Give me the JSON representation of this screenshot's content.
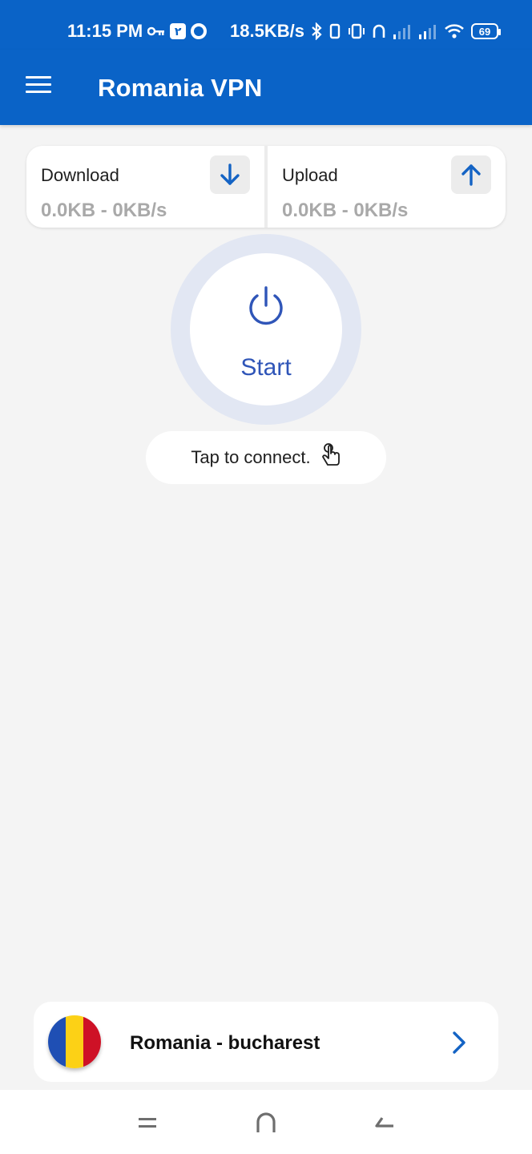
{
  "status_bar": {
    "time": "11:15 PM",
    "speed": "18.5KB/s",
    "battery": "69"
  },
  "app_bar": {
    "title": "Romania VPN"
  },
  "stats": {
    "download": {
      "label": "Download",
      "value": "0.0KB - 0KB/s"
    },
    "upload": {
      "label": "Upload",
      "value": "0.0KB - 0KB/s"
    }
  },
  "power": {
    "label": "Start"
  },
  "hint": {
    "text": "Tap to connect."
  },
  "server": {
    "name": "Romania - bucharest",
    "flag_colors": [
      "#1f4fb4",
      "#fcd116",
      "#ce1126"
    ]
  },
  "colors": {
    "brand_blue": "#0a63c7",
    "accent_blue": "#2f55b8",
    "background": "#f4f4f4"
  },
  "icons": [
    "menu-icon",
    "download-arrow-icon",
    "upload-arrow-icon",
    "power-icon",
    "hand-pointer-icon",
    "chevron-right-icon"
  ]
}
